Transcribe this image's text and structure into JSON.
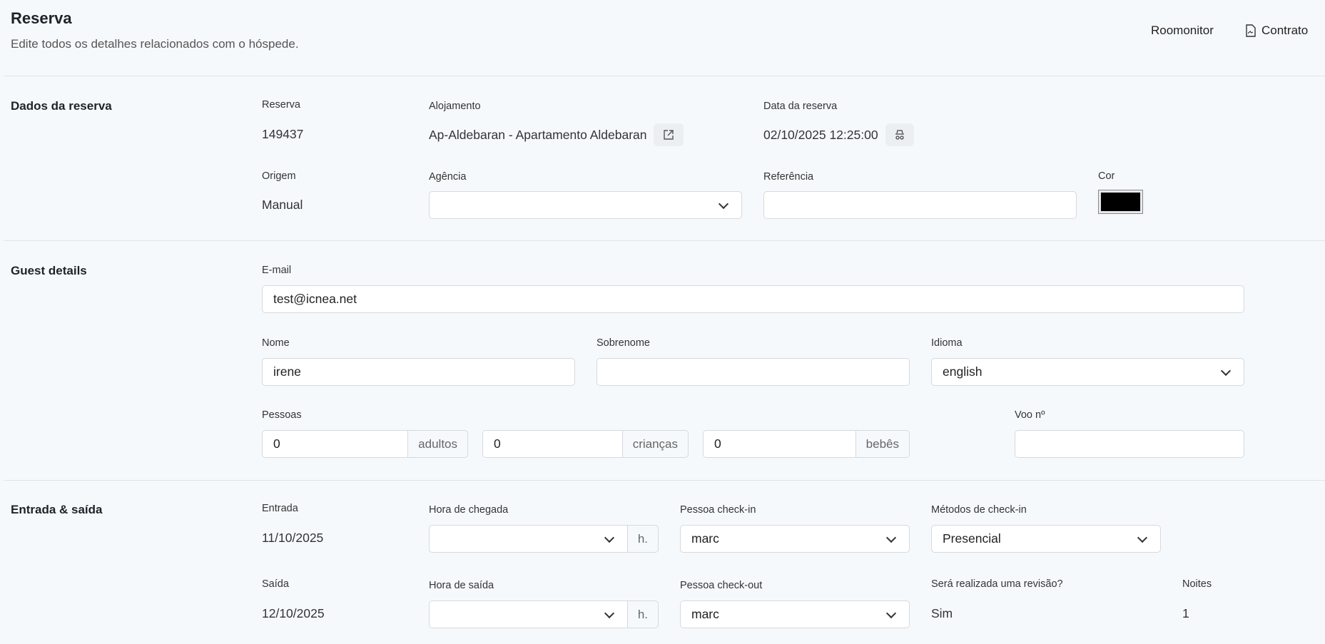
{
  "header": {
    "title": "Reserva",
    "subtitle": "Edite todos os detalhes relacionados com o hóspede.",
    "roomonitor": "Roomonitor",
    "contrato": "Contrato"
  },
  "booking": {
    "section": "Dados da reserva",
    "reserva_label": "Reserva",
    "reserva": "149437",
    "alojamento_label": "Alojamento",
    "alojamento": "Ap-Aldebaran - Apartamento Aldebaran",
    "data_label": "Data da reserva",
    "data": "02/10/2025 12:25:00",
    "origem_label": "Origem",
    "origem": "Manual",
    "agencia_label": "Agência",
    "agencia": "",
    "referencia_label": "Referência",
    "referencia": "",
    "cor_label": "Cor",
    "cor": "#000000"
  },
  "guest": {
    "section": "Guest details",
    "email_label": "E-mail",
    "email": "test@icnea.net",
    "nome_label": "Nome",
    "nome": "irene",
    "sobrenome_label": "Sobrenome",
    "sobrenome": "",
    "idioma_label": "Idioma",
    "idioma": "english",
    "pessoas_label": "Pessoas",
    "adultos": "0",
    "adultos_unit": "adultos",
    "criancas": "0",
    "criancas_unit": "crianças",
    "bebes": "0",
    "bebes_unit": "bebês",
    "voo_label": "Voo nº",
    "voo": ""
  },
  "stay": {
    "section": "Entrada & saída",
    "entrada_label": "Entrada",
    "entrada": "11/10/2025",
    "hora_chegada_label": "Hora de chegada",
    "hora_chegada": "",
    "h": "h.",
    "checkin_person_label": "Pessoa check-in",
    "checkin_person": "marc",
    "metodos_label": "Métodos de check-in",
    "metodos": "Presencial",
    "saida_label": "Saída",
    "saida": "12/10/2025",
    "hora_saida_label": "Hora de saída",
    "hora_saida": "",
    "checkout_person_label": "Pessoa check-out",
    "checkout_person": "marc",
    "revisao_label": "Será realizada uma revisão?",
    "revisao": "Sim",
    "noites_label": "Noites",
    "noites": "1"
  }
}
